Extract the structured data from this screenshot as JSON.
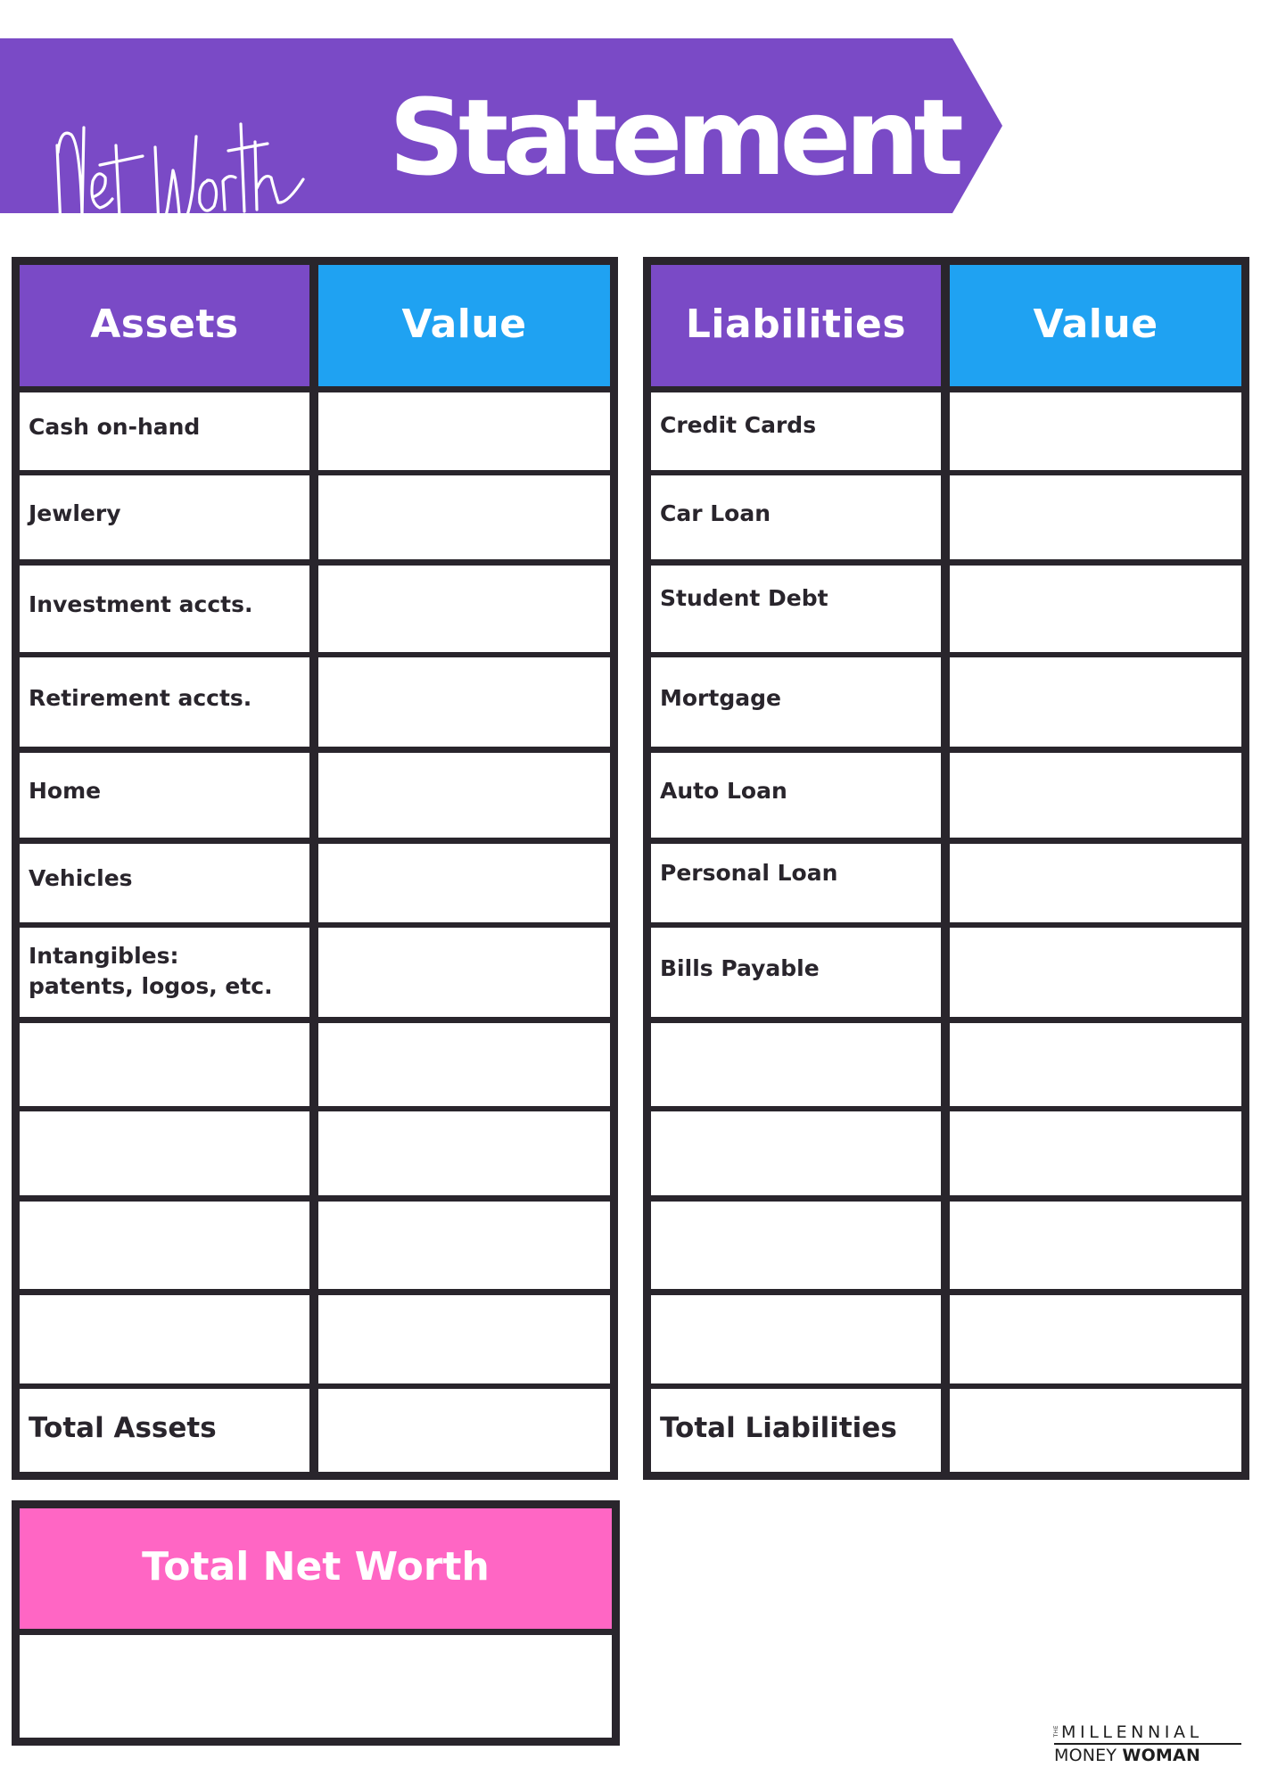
{
  "header": {
    "script_title": "Net Worth",
    "title": "Statement"
  },
  "colors": {
    "purple": "#7a4ac6",
    "blue": "#1fa2f2",
    "pink": "#ff66c4",
    "border": "#29252c"
  },
  "assets": {
    "label_header": "Assets",
    "value_header": "Value",
    "rows": [
      {
        "label": "Cash on-hand",
        "value": ""
      },
      {
        "label": "Jewlery",
        "value": ""
      },
      {
        "label": "Investment accts.",
        "value": ""
      },
      {
        "label": "Retirement accts.",
        "value": ""
      },
      {
        "label": "Home",
        "value": ""
      },
      {
        "label": "Vehicles",
        "value": ""
      },
      {
        "label": "Intangibles:\npatents, logos, etc.",
        "value": ""
      },
      {
        "label": "",
        "value": ""
      },
      {
        "label": "",
        "value": ""
      },
      {
        "label": "",
        "value": ""
      },
      {
        "label": "",
        "value": ""
      }
    ],
    "total_label": "Total Assets",
    "total_value": ""
  },
  "liabilities": {
    "label_header": "Liabilities",
    "value_header": "Value",
    "rows": [
      {
        "label": "Credit Cards",
        "value": ""
      },
      {
        "label": "Car Loan",
        "value": ""
      },
      {
        "label": "Student Debt",
        "value": ""
      },
      {
        "label": "Mortgage",
        "value": ""
      },
      {
        "label": "Auto Loan",
        "value": ""
      },
      {
        "label": "Personal Loan",
        "value": ""
      },
      {
        "label": "Bills Payable",
        "value": ""
      },
      {
        "label": "",
        "value": ""
      },
      {
        "label": "",
        "value": ""
      },
      {
        "label": "",
        "value": ""
      },
      {
        "label": "",
        "value": ""
      }
    ],
    "total_label": "Total Liabilities",
    "total_value": ""
  },
  "net_worth": {
    "label": "Total Net Worth",
    "value": ""
  },
  "logo": {
    "the": "THE",
    "line1": "MILLENNIAL",
    "line2_regular": "MONEY",
    "line2_bold": "WOMAN"
  }
}
